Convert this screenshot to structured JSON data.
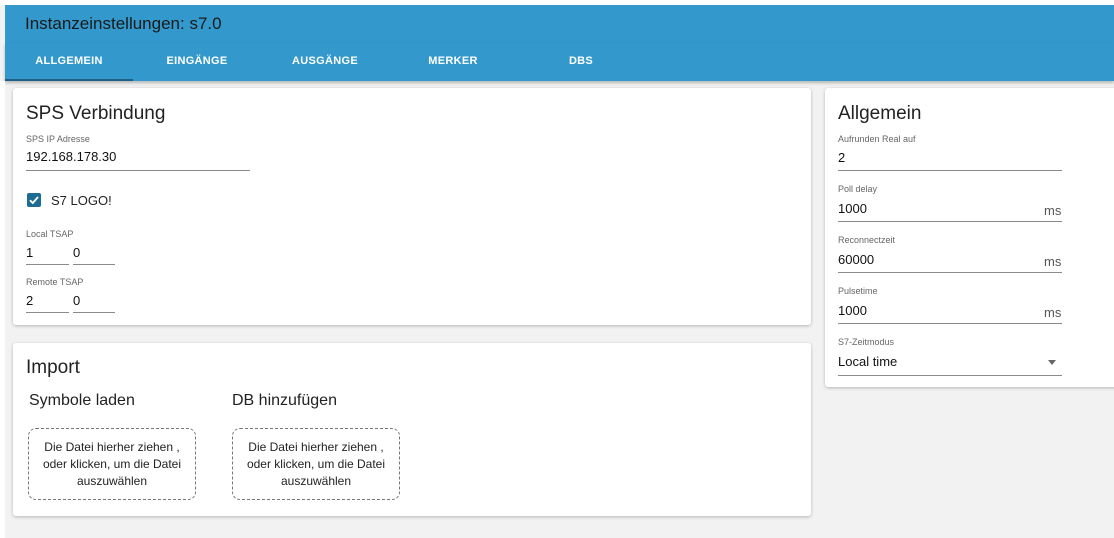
{
  "header": {
    "title": "Instanzeinstellungen: s7.0"
  },
  "tabs": [
    {
      "label": "ALLGEMEIN"
    },
    {
      "label": "EINGÄNGE"
    },
    {
      "label": "AUSGÄNGE"
    },
    {
      "label": "MERKER"
    },
    {
      "label": "DBS"
    }
  ],
  "connection": {
    "title": "SPS Verbindung",
    "ip_label": "SPS IP Adresse",
    "ip_value": "192.168.178.30",
    "logo_label": "S7 LOGO!",
    "logo_checked": true,
    "local_tsap_label": "Local TSAP",
    "local_tsap": [
      "1",
      "0"
    ],
    "remote_tsap_label": "Remote TSAP",
    "remote_tsap": [
      "2",
      "0"
    ]
  },
  "import": {
    "title": "Import",
    "symbols_title": "Symbole laden",
    "db_title": "DB hinzufügen",
    "dropzone_text": "Die Datei hierher ziehen , oder klicken, um die Datei auszuwählen"
  },
  "general": {
    "title": "Allgemein",
    "round_label": "Aufrunden Real auf",
    "round_value": "2",
    "poll_label": "Poll delay",
    "poll_value": "1000",
    "reconnect_label": "Reconnectzeit",
    "reconnect_value": "60000",
    "pulse_label": "Pulsetime",
    "pulse_value": "1000",
    "unit": "ms",
    "timemode_label": "S7-Zeitmodus",
    "timemode_value": "Local time"
  },
  "colors": {
    "accent": "#3399cc",
    "checkbox": "#1e6b93"
  },
  "icons": {
    "checkbox": "check-icon",
    "dropdown": "dropdown-caret-icon"
  }
}
